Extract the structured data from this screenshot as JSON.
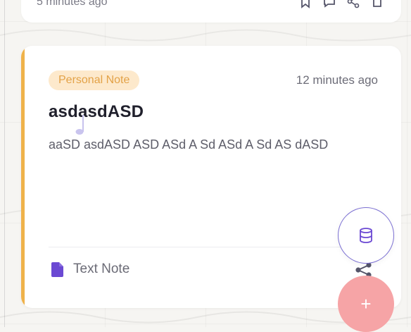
{
  "previous_card": {
    "time": "5 minutes ago",
    "actions": [
      "bookmark-icon",
      "comment-icon",
      "share-icon",
      "delete-icon"
    ]
  },
  "note_card": {
    "badge": "Personal Note",
    "time_ago": "12 minutes ago",
    "title": "asdasdASD",
    "body": "aaSD asdASD ASD ASd A Sd ASd A Sd AS dASD",
    "type_label": "Text Note",
    "type_icon": "document-icon",
    "accent_color": "#efb24a"
  },
  "fab": {
    "database_icon": "database-icon",
    "add_label": "+"
  },
  "colors": {
    "badge_bg": "#fde9cc",
    "badge_text": "#e3a247",
    "brand_purple": "#6b49d3",
    "fab_add_bg": "#f6a4a6"
  }
}
